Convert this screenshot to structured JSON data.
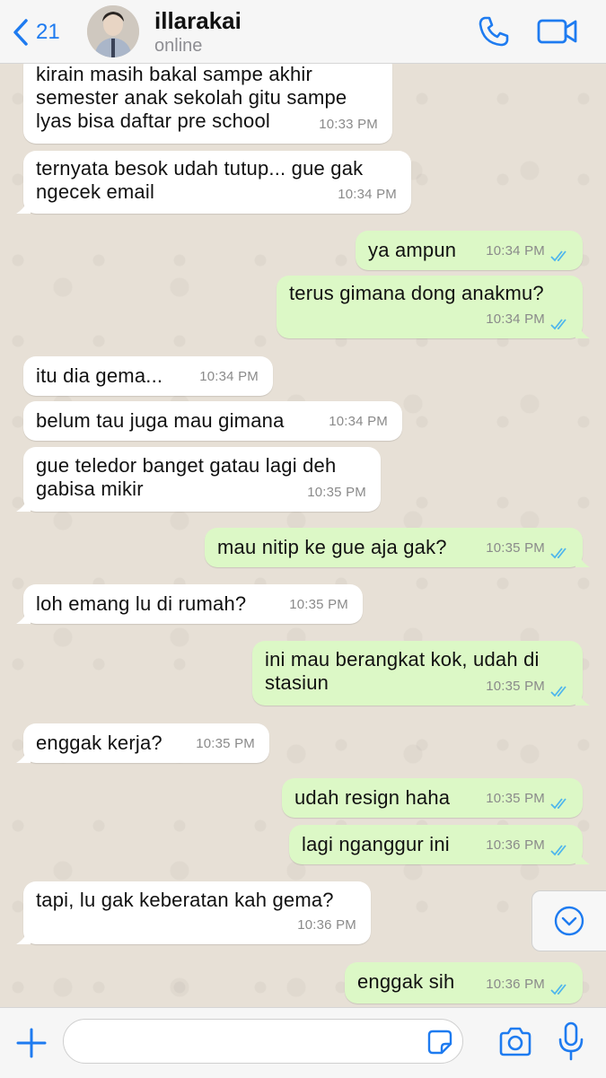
{
  "header": {
    "back_count": "21",
    "contact_name": "illarakai",
    "contact_status": "online",
    "icons": [
      "chevron-left-icon",
      "phone-icon",
      "video-icon"
    ]
  },
  "messages": [
    {
      "dir": "in",
      "text": "kirain masih bakal sampe akhir\nsemester anak sekolah gitu sampe\nlyas bisa daftar pre school",
      "time": "10:33 PM"
    },
    {
      "dir": "in",
      "text": "ternyata besok udah tutup... gue gak\nngecek email",
      "time": "10:34 PM"
    },
    {
      "dir": "out",
      "text": "ya ampun",
      "time": "10:34 PM"
    },
    {
      "dir": "out",
      "text": "terus gimana dong anakmu?",
      "time": "10:34 PM"
    },
    {
      "dir": "in",
      "text": "itu dia gema...",
      "time": "10:34 PM"
    },
    {
      "dir": "in",
      "text": "belum tau juga mau gimana",
      "time": "10:34 PM"
    },
    {
      "dir": "in",
      "text": "gue teledor banget gatau lagi deh\ngabisa mikir",
      "time": "10:35 PM"
    },
    {
      "dir": "out",
      "text": "mau nitip ke gue aja gak?",
      "time": "10:35 PM"
    },
    {
      "dir": "in",
      "text": "loh emang lu di rumah?",
      "time": "10:35 PM"
    },
    {
      "dir": "out",
      "text": "ini mau berangkat kok, udah di\nstasiun",
      "time": "10:35 PM"
    },
    {
      "dir": "in",
      "text": "enggak kerja?",
      "time": "10:35 PM"
    },
    {
      "dir": "out",
      "text": "udah resign haha",
      "time": "10:35 PM"
    },
    {
      "dir": "out",
      "text": "lagi nganggur ini",
      "time": "10:36 PM"
    },
    {
      "dir": "in",
      "text": "tapi, lu gak keberatan kah gema?",
      "time": "10:36 PM"
    },
    {
      "dir": "out",
      "text": "enggak sih",
      "time": "10:36 PM"
    }
  ],
  "input": {
    "placeholder": "",
    "value": ""
  },
  "colors": {
    "accent": "#1e7bf0",
    "outgoing_bubble": "#dcf8c6",
    "incoming_bubble": "#ffffff",
    "read_ticks": "#4fb6ec"
  }
}
